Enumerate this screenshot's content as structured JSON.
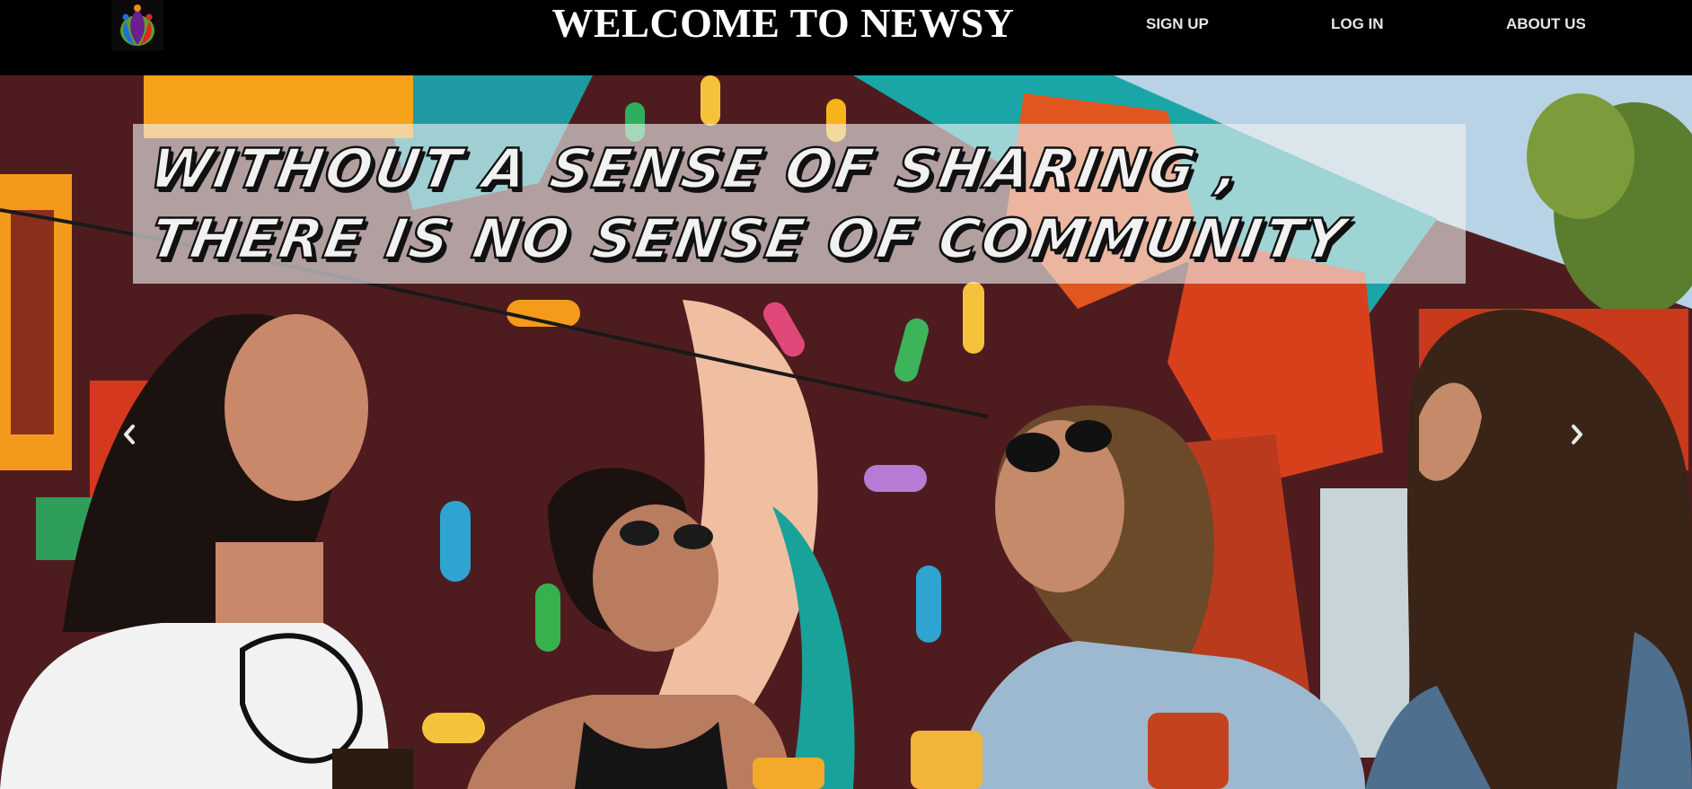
{
  "header": {
    "title": "WELCOME TO NEWSY",
    "nav": {
      "signup": "SIGN UP",
      "login": "LOG IN",
      "about": "ABOUT US"
    }
  },
  "hero": {
    "caption": {
      "line1": "WITHOUT A SENSE OF SHARING ,",
      "line2": "THERE IS NO SENSE OF COMMUNITY"
    },
    "controls": {
      "prev_icon": "chevron-left-icon",
      "next_icon": "chevron-right-icon"
    }
  },
  "colors": {
    "navbar_bg": "#000000",
    "nav_text": "#e6e6e6",
    "caption_overlay": "#f0f0f0"
  }
}
